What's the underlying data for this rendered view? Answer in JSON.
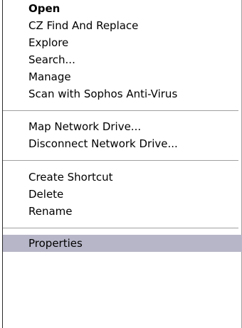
{
  "menu": {
    "items": [
      {
        "label": "Open"
      },
      {
        "label": "CZ Find And Replace"
      },
      {
        "label": "Explore"
      },
      {
        "label": "Search..."
      },
      {
        "label": "Manage"
      },
      {
        "label": "Scan with Sophos Anti-Virus"
      },
      {
        "label": "Map Network Drive..."
      },
      {
        "label": "Disconnect Network Drive..."
      },
      {
        "label": "Create Shortcut"
      },
      {
        "label": "Delete"
      },
      {
        "label": "Rename"
      },
      {
        "label": "Properties"
      }
    ],
    "selected_color": "#b6b6c8",
    "selected_item": "Properties",
    "default_item": "Open"
  }
}
